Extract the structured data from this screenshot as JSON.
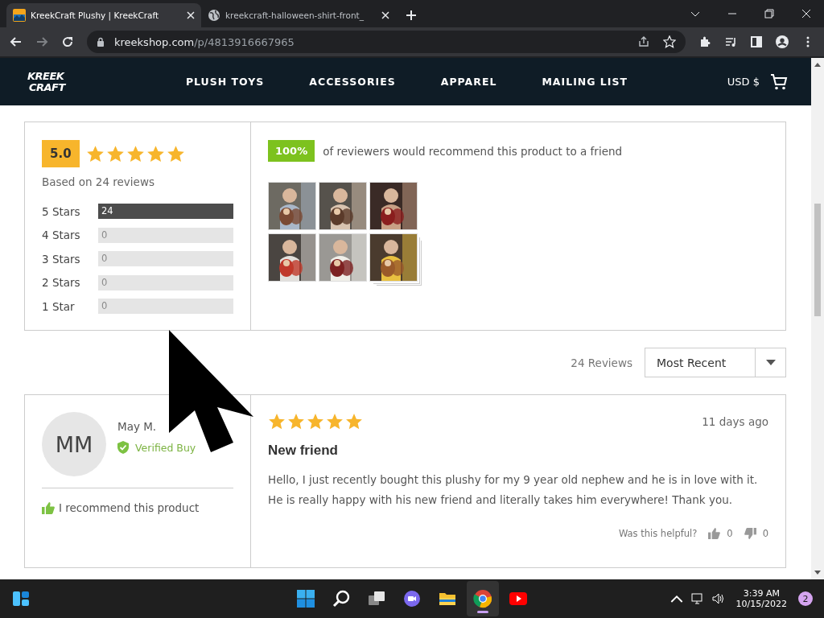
{
  "browser": {
    "tabs": [
      {
        "title": "KreekCraft Plushy | KreekCraft",
        "selected": true,
        "kind": "site"
      },
      {
        "title": "kreekcraft-halloween-shirt-front_",
        "selected": false,
        "kind": "globe"
      }
    ],
    "url_host": "kreekshop.com",
    "url_path": "/p/4813916667965"
  },
  "site_nav": {
    "logo_lines": [
      "KREEK",
      "CRAFT"
    ],
    "items": [
      "PLUSH TOYS",
      "ACCESSORIES",
      "APPAREL",
      "MAILING LIST"
    ],
    "currency": "USD $"
  },
  "summary": {
    "score": "5.0",
    "stars": 5,
    "based_on": "Based on 24 reviews",
    "histogram": [
      {
        "label": "5 Stars",
        "count": "24",
        "level": 1
      },
      {
        "label": "4 Stars",
        "count": "0",
        "level": 0
      },
      {
        "label": "3 Stars",
        "count": "0",
        "level": 0
      },
      {
        "label": "2 Stars",
        "count": "0",
        "level": 0
      },
      {
        "label": "1 Star",
        "count": "0",
        "level": 0
      }
    ],
    "recommend_percent": "100%",
    "recommend_text": "of reviewers would recommend this product to a friend",
    "photos": [
      {
        "kind": "picture"
      },
      {
        "kind": "picture"
      },
      {
        "kind": "picture"
      },
      {
        "kind": "picture"
      },
      {
        "kind": "picture"
      },
      {
        "kind": "picture",
        "stacked": true
      }
    ]
  },
  "reviews_header": {
    "count": "24 Reviews",
    "sort": "Most Recent"
  },
  "review": {
    "initials": "MM",
    "name": "May M.",
    "verified": "Verified Buy",
    "recommend": "I recommend this product",
    "stars": 5,
    "date": "11 days ago",
    "title": "New friend",
    "body": "Hello, I just recently bought this plushy for my 9 year old nephew and he is in love with it. He is really happy with his new friend and literally takes him everywhere! Thank you.",
    "helpful_label": "Was this helpful?",
    "helpful_up": "0",
    "helpful_down": "0"
  },
  "taskbar": {
    "time": "3:39 AM",
    "date": "10/15/2022",
    "notifications": "2"
  }
}
